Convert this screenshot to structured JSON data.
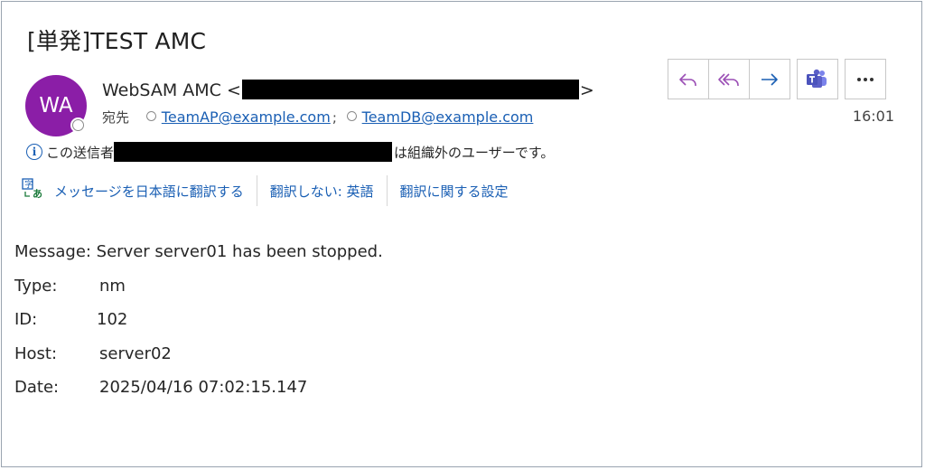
{
  "subject": "[単発]TEST AMC",
  "sender": {
    "avatar_initials": "WA",
    "name_prefix": "WebSAM AMC <",
    "name_suffix": ">"
  },
  "recipients": {
    "label": "宛先",
    "list": [
      "TeamAP@example.com",
      "TeamDB@example.com"
    ],
    "separator": ";"
  },
  "external_warning": {
    "prefix": "この送信者",
    "suffix": "は組織外のユーザーです。"
  },
  "translation_bar": {
    "translate": "メッセージを日本語に翻訳する",
    "dont_translate": "翻訳しない: 英語",
    "settings": "翻訳に関する設定"
  },
  "actions": {
    "reply_icon": "reply-icon",
    "reply_all_icon": "reply-all-icon",
    "forward_icon": "forward-icon",
    "teams_icon": "teams-icon",
    "more_icon": "more-icon"
  },
  "timestamp": "16:01",
  "message": {
    "line_message": "Message: Server server01 has been stopped.",
    "fields": [
      {
        "label": "Type:",
        "value": "nm"
      },
      {
        "label": "ID:",
        "value": "102"
      },
      {
        "label": "Host:",
        "value": "server02"
      },
      {
        "label": "Date:",
        "value": "2025/04/16 07:02:15.147"
      }
    ]
  },
  "colors": {
    "avatar": "#8b1ea7",
    "link": "#1a5fb4",
    "accent_purple": "#9b4fb5",
    "teams": "#5b5fc7"
  }
}
